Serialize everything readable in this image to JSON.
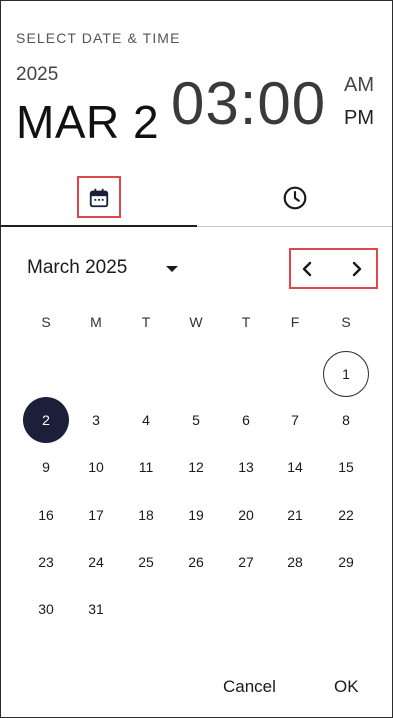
{
  "toolbar": {
    "title": "SELECT DATE & TIME",
    "year": "2025",
    "date": "MAR 2",
    "time": "03:00",
    "am": "AM",
    "pm": "PM"
  },
  "tabs": [
    {
      "name": "date",
      "icon": "calendar-icon"
    },
    {
      "name": "time",
      "icon": "clock-icon"
    }
  ],
  "calendar": {
    "month_label": "March 2025",
    "weekdays": [
      "S",
      "M",
      "T",
      "W",
      "T",
      "F",
      "S"
    ],
    "weeks": [
      [
        "",
        "",
        "",
        "",
        "",
        "",
        "1"
      ],
      [
        "2",
        "3",
        "4",
        "5",
        "6",
        "7",
        "8"
      ],
      [
        "9",
        "10",
        "11",
        "12",
        "13",
        "14",
        "15"
      ],
      [
        "16",
        "17",
        "18",
        "19",
        "20",
        "21",
        "22"
      ],
      [
        "23",
        "24",
        "25",
        "26",
        "27",
        "28",
        "29"
      ],
      [
        "30",
        "31",
        "",
        "",
        "",
        "",
        ""
      ]
    ],
    "today": "1",
    "selected": "2"
  },
  "actions": {
    "cancel": "Cancel",
    "ok": "OK"
  },
  "colors": {
    "selected_bg": "#1b1f3a",
    "highlight": "#e0474c"
  }
}
